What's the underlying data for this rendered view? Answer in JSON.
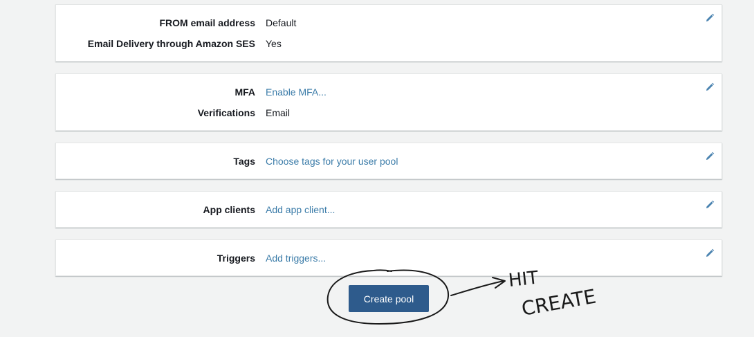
{
  "sections": [
    {
      "rows": [
        {
          "label": "FROM email address",
          "value": "Default"
        },
        {
          "label": "Email Delivery through Amazon SES",
          "value": "Yes"
        }
      ]
    },
    {
      "rows": [
        {
          "label": "MFA",
          "value": "Enable MFA..."
        },
        {
          "label": "Verifications",
          "value": "Email"
        }
      ]
    },
    {
      "rows": [
        {
          "label": "Tags",
          "value": "Choose tags for your user pool"
        }
      ]
    },
    {
      "rows": [
        {
          "label": "App clients",
          "value": "Add app client..."
        }
      ]
    },
    {
      "rows": [
        {
          "label": "Triggers",
          "value": "Add triggers..."
        }
      ]
    }
  ],
  "create_button": {
    "label": "Create pool"
  },
  "annotation": {
    "text_line1": "HIT",
    "text_line2": "CREATE"
  },
  "icons": {
    "edit": "pencil-icon"
  },
  "colors": {
    "background": "#f2f3f3",
    "link": "#3a7ba8",
    "primary_button": "#2e5b8c",
    "annotation_ink": "#1a1a1a"
  }
}
